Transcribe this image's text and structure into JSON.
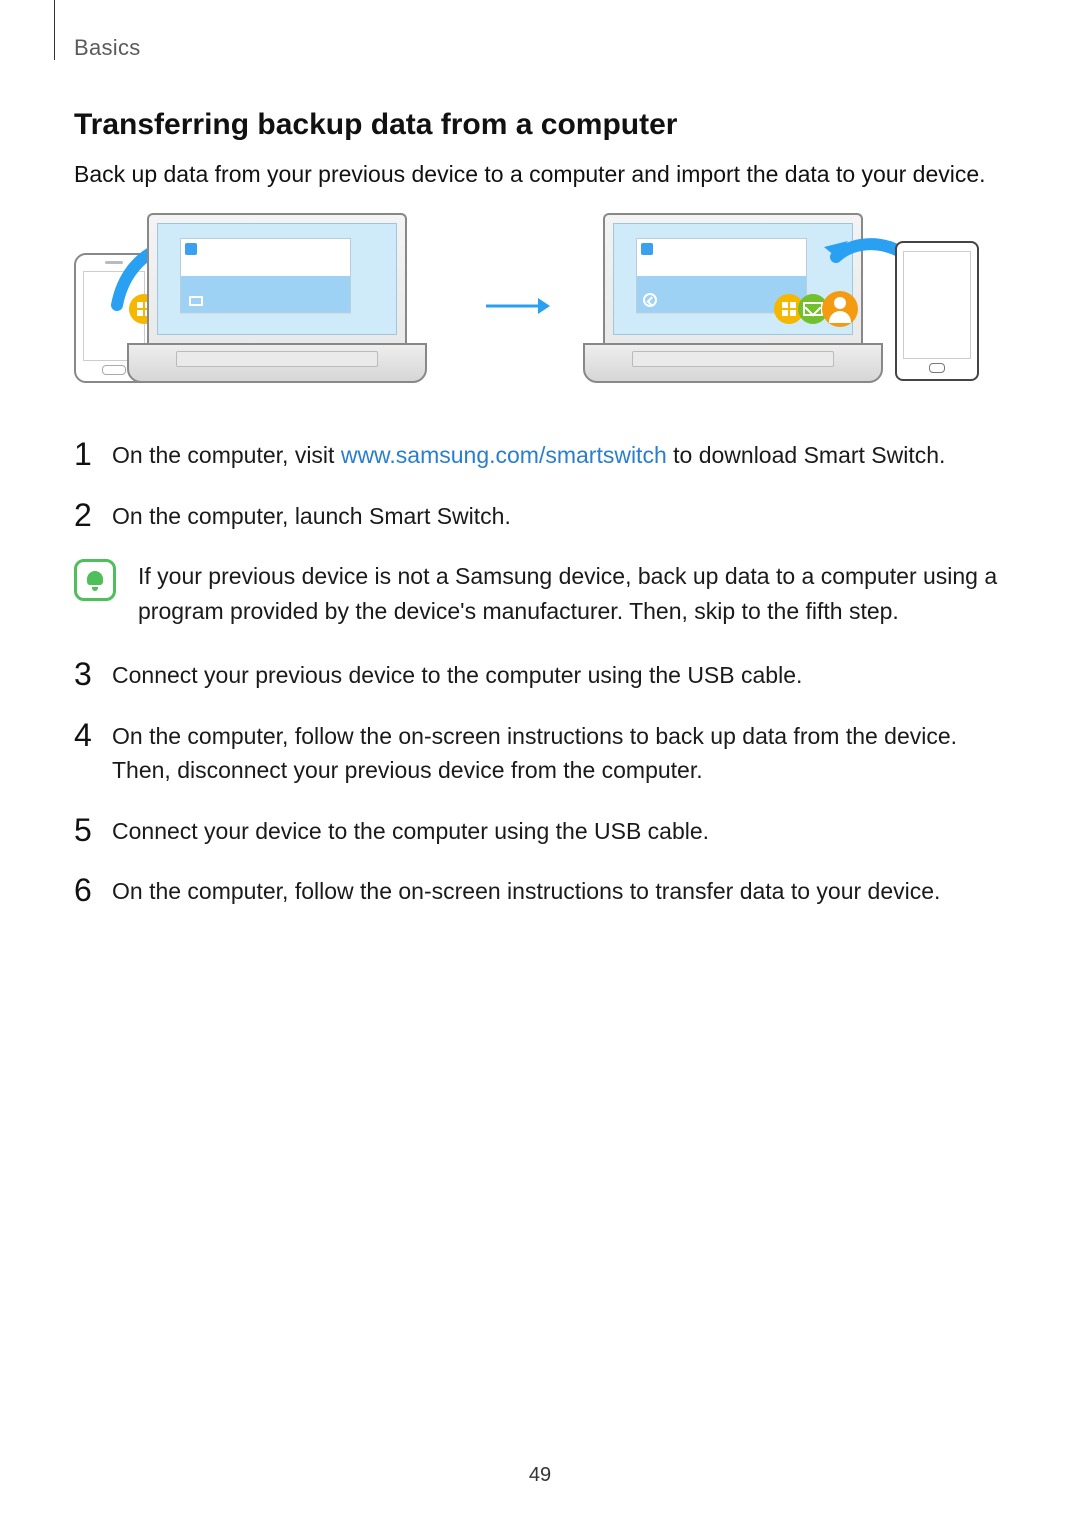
{
  "breadcrumb": "Basics",
  "title": "Transferring backup data from a computer",
  "intro": "Back up data from your previous device to a computer and import the data to your device.",
  "link": {
    "label": "www.samsung.com/smartswitch",
    "href": "http://www.samsung.com/smartswitch"
  },
  "steps": {
    "s1_a": "On the computer, visit ",
    "s1_b": " to download Smart Switch.",
    "s2": "On the computer, launch Smart Switch.",
    "s3": "Connect your previous device to the computer using the USB cable.",
    "s4": "On the computer, follow the on-screen instructions to back up data from the device. Then, disconnect your previous device from the computer.",
    "s5": "Connect your device to the computer using the USB cable.",
    "s6": "On the computer, follow the on-screen instructions to transfer data to your device."
  },
  "nums": {
    "n1": "1",
    "n2": "2",
    "n3": "3",
    "n4": "4",
    "n5": "5",
    "n6": "6"
  },
  "note": "If your previous device is not a Samsung device, back up data to a computer using a program provided by the device's manufacturer. Then, skip to the fifth step.",
  "page_number": "49"
}
